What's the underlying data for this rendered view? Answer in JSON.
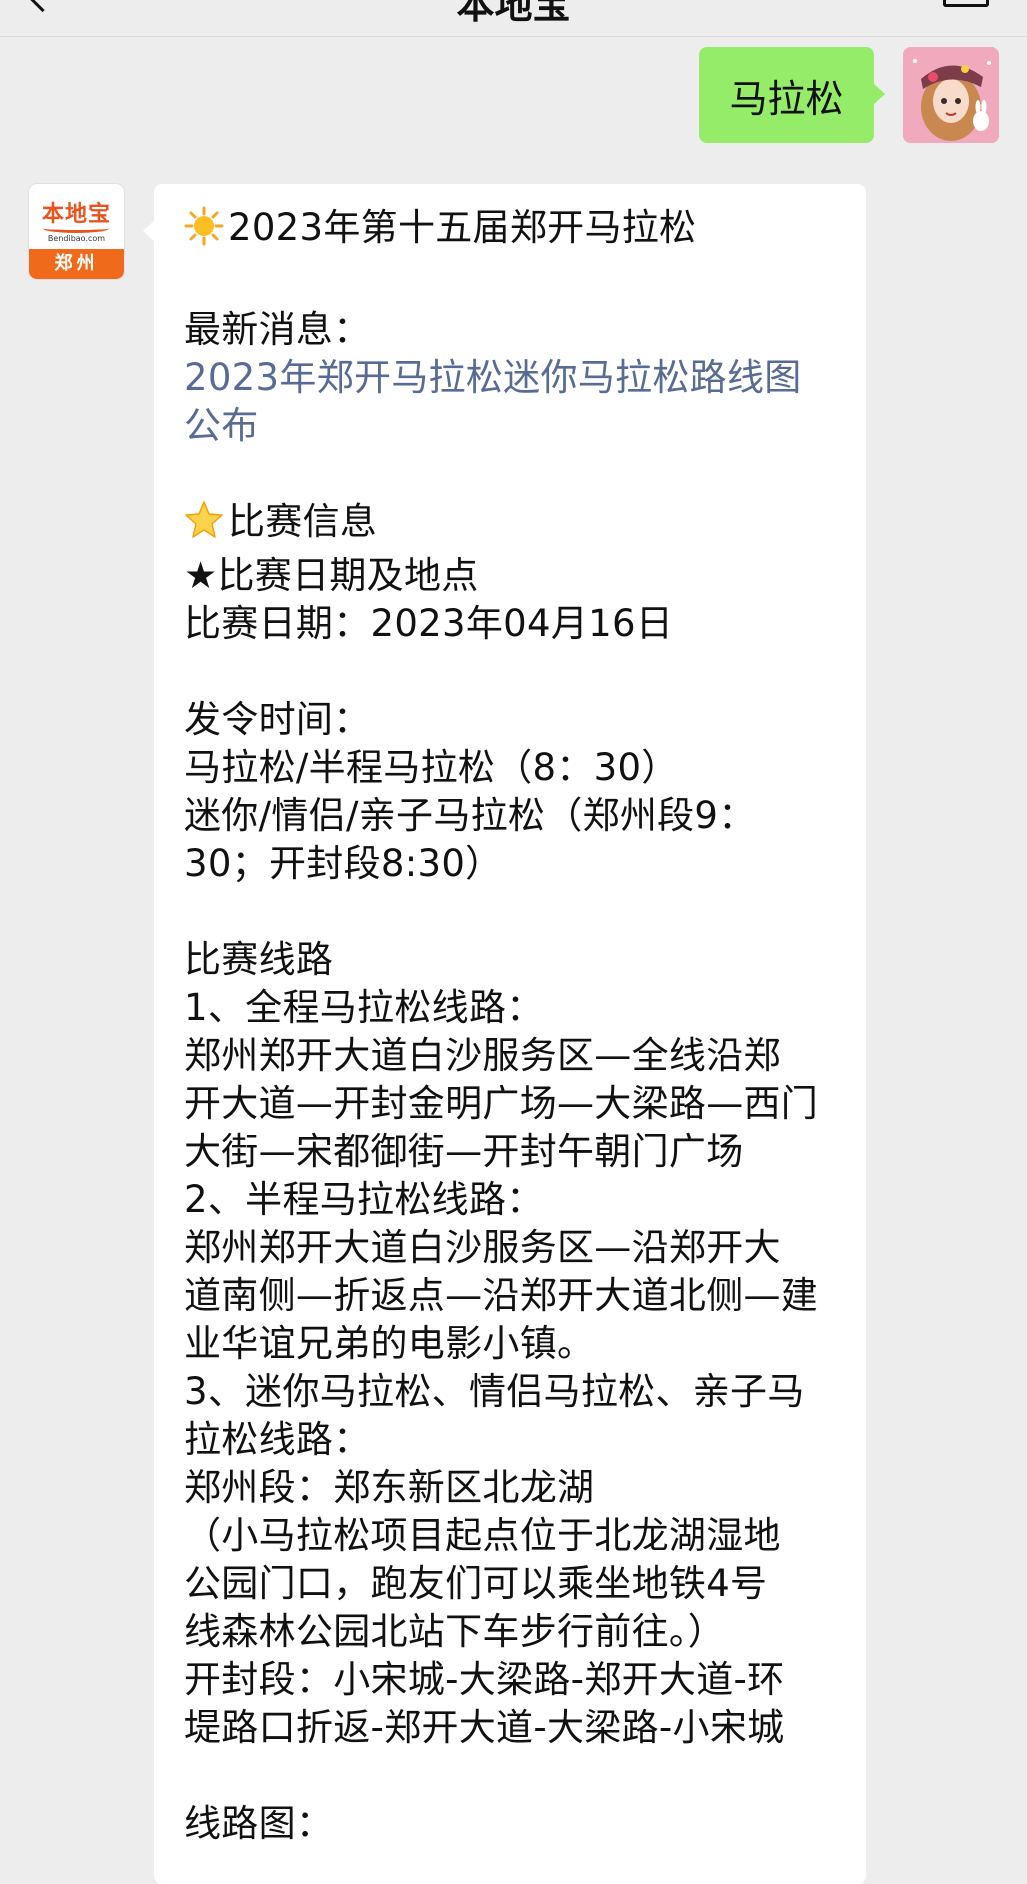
{
  "header": {
    "title": "本地宝"
  },
  "outgoing": {
    "text": "马拉松"
  },
  "incoming_avatar": {
    "logo_text": "本地宝",
    "logo_sub": "Bendibao.com",
    "city": "郑州"
  },
  "message": {
    "title": "2023年第十五届郑开马拉松",
    "news_label": "最新消息：",
    "news_link_1": "2023年郑开马拉松迷你马拉松路线图",
    "news_link_2": "公布",
    "section_info": "比赛信息",
    "date_place_heading": "★比赛日期及地点",
    "race_date": "比赛日期：2023年04月16日",
    "start_time_label": "发令时间：",
    "start_time_1": "马拉松/半程马拉松（8：30）",
    "start_time_2a": "迷你/情侣/亲子马拉松（郑州段9：",
    "start_time_2b": "30；开封段8:30）",
    "route_heading": "比赛线路",
    "route1_label": "1、全程马拉松线路：",
    "route1_a": "郑州郑开大道白沙服务区—全线沿郑",
    "route1_b": "开大道—开封金明广场—大梁路—西门",
    "route1_c": "大街—宋都御街—开封午朝门广场",
    "route2_label": "2、半程马拉松线路：",
    "route2_a": "郑州郑开大道白沙服务区—沿郑开大",
    "route2_b": "道南侧—折返点—沿郑开大道北侧—建",
    "route2_c": "业华谊兄弟的电影小镇。",
    "route3_label_a": "3、迷你马拉松、情侣马拉松、亲子马",
    "route3_label_b": "拉松线路：",
    "zz_segment": "郑州段：郑东新区北龙湖",
    "zz_note_a": "（小马拉松项目起点位于北龙湖湿地",
    "zz_note_b": "公园门口，跑友们可以乘坐地铁4号",
    "zz_note_c": "线森林公园北站下车步行前往。）",
    "kf_segment_a": "开封段：小宋城-大梁路-郑开大道-环",
    "kf_segment_b": "堤路口折返-郑开大道-大梁路-小宋城",
    "map_label": "线路图："
  },
  "colors": {
    "background": "#ededed",
    "outgoing_bubble": "#95ec69",
    "link": "#576b95",
    "logo_orange": "#ef6a1a"
  },
  "icons": {
    "title_emoji": "sun-icon",
    "section_emoji": "star-icon"
  }
}
